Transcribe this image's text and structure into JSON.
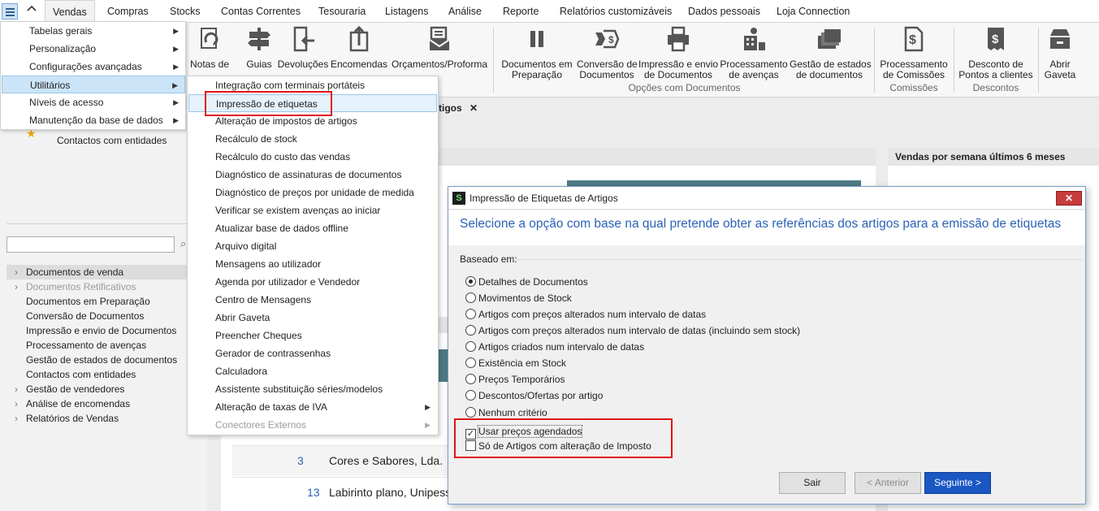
{
  "menubar": {
    "items": [
      "Vendas",
      "Compras",
      "Stocks",
      "Contas Correntes",
      "Tesouraria",
      "Listagens",
      "Análise",
      "Reporte",
      "Relatórios customizáveis",
      "Dados pessoais",
      "Loja Connection"
    ]
  },
  "ribbon": {
    "buttons": [
      {
        "label": "Notas de\ncrédito/débito",
        "icon": "refresh-doc-icon"
      },
      {
        "label": "Guias",
        "icon": "signpost-icon"
      },
      {
        "label": "Devoluções",
        "icon": "return-doc-icon"
      },
      {
        "label": "Encomendas",
        "icon": "upload-doc-icon"
      },
      {
        "label": "Orçamentos/Proforma",
        "icon": "envelope-doc-icon"
      },
      {
        "label": "Documentos em\nPreparação",
        "icon": "pause-icon"
      },
      {
        "label": "Conversão de\nDocumentos",
        "icon": "convert-money-icon"
      },
      {
        "label": "Impressão e envio\nde Documentos",
        "icon": "printer-icon"
      },
      {
        "label": "Processamento\nde avenças",
        "icon": "building-person-icon"
      },
      {
        "label": "Gestão de estados\nde documentos",
        "icon": "stacked-docs-icon"
      },
      {
        "label": "Processamento\nde Comissões",
        "icon": "dollar-doc-icon"
      },
      {
        "label": "Desconto de\nPontos a clientes",
        "icon": "dollar-receipt-icon"
      },
      {
        "label": "Abrir\nGaveta",
        "icon": "cash-drawer-icon"
      }
    ],
    "groups": [
      "Opções com Documentos",
      "Comissões",
      "Descontos"
    ]
  },
  "dropdown": {
    "items": [
      {
        "label": "Tabelas gerais",
        "sub": true
      },
      {
        "label": "Personalização",
        "sub": true
      },
      {
        "label": "Configurações avançadas",
        "sub": true
      },
      {
        "label": "Utilitários",
        "sub": true
      },
      {
        "label": "Níveis de acesso",
        "sub": true
      },
      {
        "label": "Manutenção da base de dados",
        "sub": true
      }
    ]
  },
  "submenu": {
    "items": [
      "Integração com terminais portáteis",
      "Impressão de etiquetas",
      "Alteração de impostos de artigos",
      "Recálculo de stock",
      "Recálculo do custo das vendas",
      "Diagnóstico de assinaturas de documentos",
      "Diagnóstico de preços por unidade de medida",
      "Verificar se existem avenças ao iniciar",
      "Atualizar base de dados offline",
      "Arquivo digital",
      "Mensagens ao utilizador",
      "Agenda por utilizador e Vendedor",
      "Centro de Mensagens",
      "Abrir Gaveta",
      "Preencher Cheques",
      "Gerador de contrassenhas",
      "Calculadora",
      "Assistente substituição séries/modelos",
      "Alteração de taxas de IVA",
      "Conectores Externos"
    ]
  },
  "left": {
    "fav_item": "Contactos com entidades",
    "tree": [
      {
        "label": "Documentos de venda",
        "arrow": true,
        "selected": true
      },
      {
        "label": "Documentos Retificativos",
        "arrow": true,
        "disabled": true
      },
      {
        "label": "Documentos em Preparação"
      },
      {
        "label": "Conversão de Documentos"
      },
      {
        "label": "Impressão e envio de Documentos"
      },
      {
        "label": "Processamento de avenças"
      },
      {
        "label": "Gestão de estados de documentos"
      },
      {
        "label": "Contactos com entidades"
      },
      {
        "label": "Gestão de vendedores",
        "arrow": true
      },
      {
        "label": "Análise de encomendas",
        "arrow": true
      },
      {
        "label": "Relatórios de Vendas",
        "arrow": true
      }
    ]
  },
  "main": {
    "tab_label": "tigos",
    "panel_title": "Vendas por semana últimos 6 meses",
    "rows": [
      {
        "num": "3",
        "name": "Cores e Sabores, Lda."
      },
      {
        "num": "13",
        "name": "Labirinto plano, Unipessoal"
      }
    ]
  },
  "dialog": {
    "title": "Impressão de Etiquetas de Artigos",
    "heading": "Selecione a opção com base na qual pretende obter as referências dos artigos para a emissão de etiquetas",
    "based_on_label": "Baseado em:",
    "options": [
      {
        "label": "Detalhes de Documentos",
        "checked": true
      },
      {
        "label": "Movimentos de Stock",
        "checked": false
      },
      {
        "label": "Artigos com preços alterados num intervalo de datas",
        "checked": false
      },
      {
        "label": "Artigos com preços alterados num intervalo de datas (incluindo sem stock)",
        "checked": false
      },
      {
        "label": "Artigos criados num intervalo de datas",
        "checked": false
      },
      {
        "label": "Existência em Stock",
        "checked": false
      },
      {
        "label": "Preços Temporários",
        "checked": false
      },
      {
        "label": "Descontos/Ofertas por artigo",
        "checked": false
      },
      {
        "label": "Nenhum critério",
        "checked": false
      }
    ],
    "checkboxes": [
      {
        "label": "Usar preços agendados",
        "checked": true
      },
      {
        "label": "Só de Artigos com alteração de Imposto",
        "checked": false
      }
    ],
    "buttons": {
      "exit": "Sair",
      "previous": "< Anterior",
      "next": "Seguinte >"
    }
  }
}
